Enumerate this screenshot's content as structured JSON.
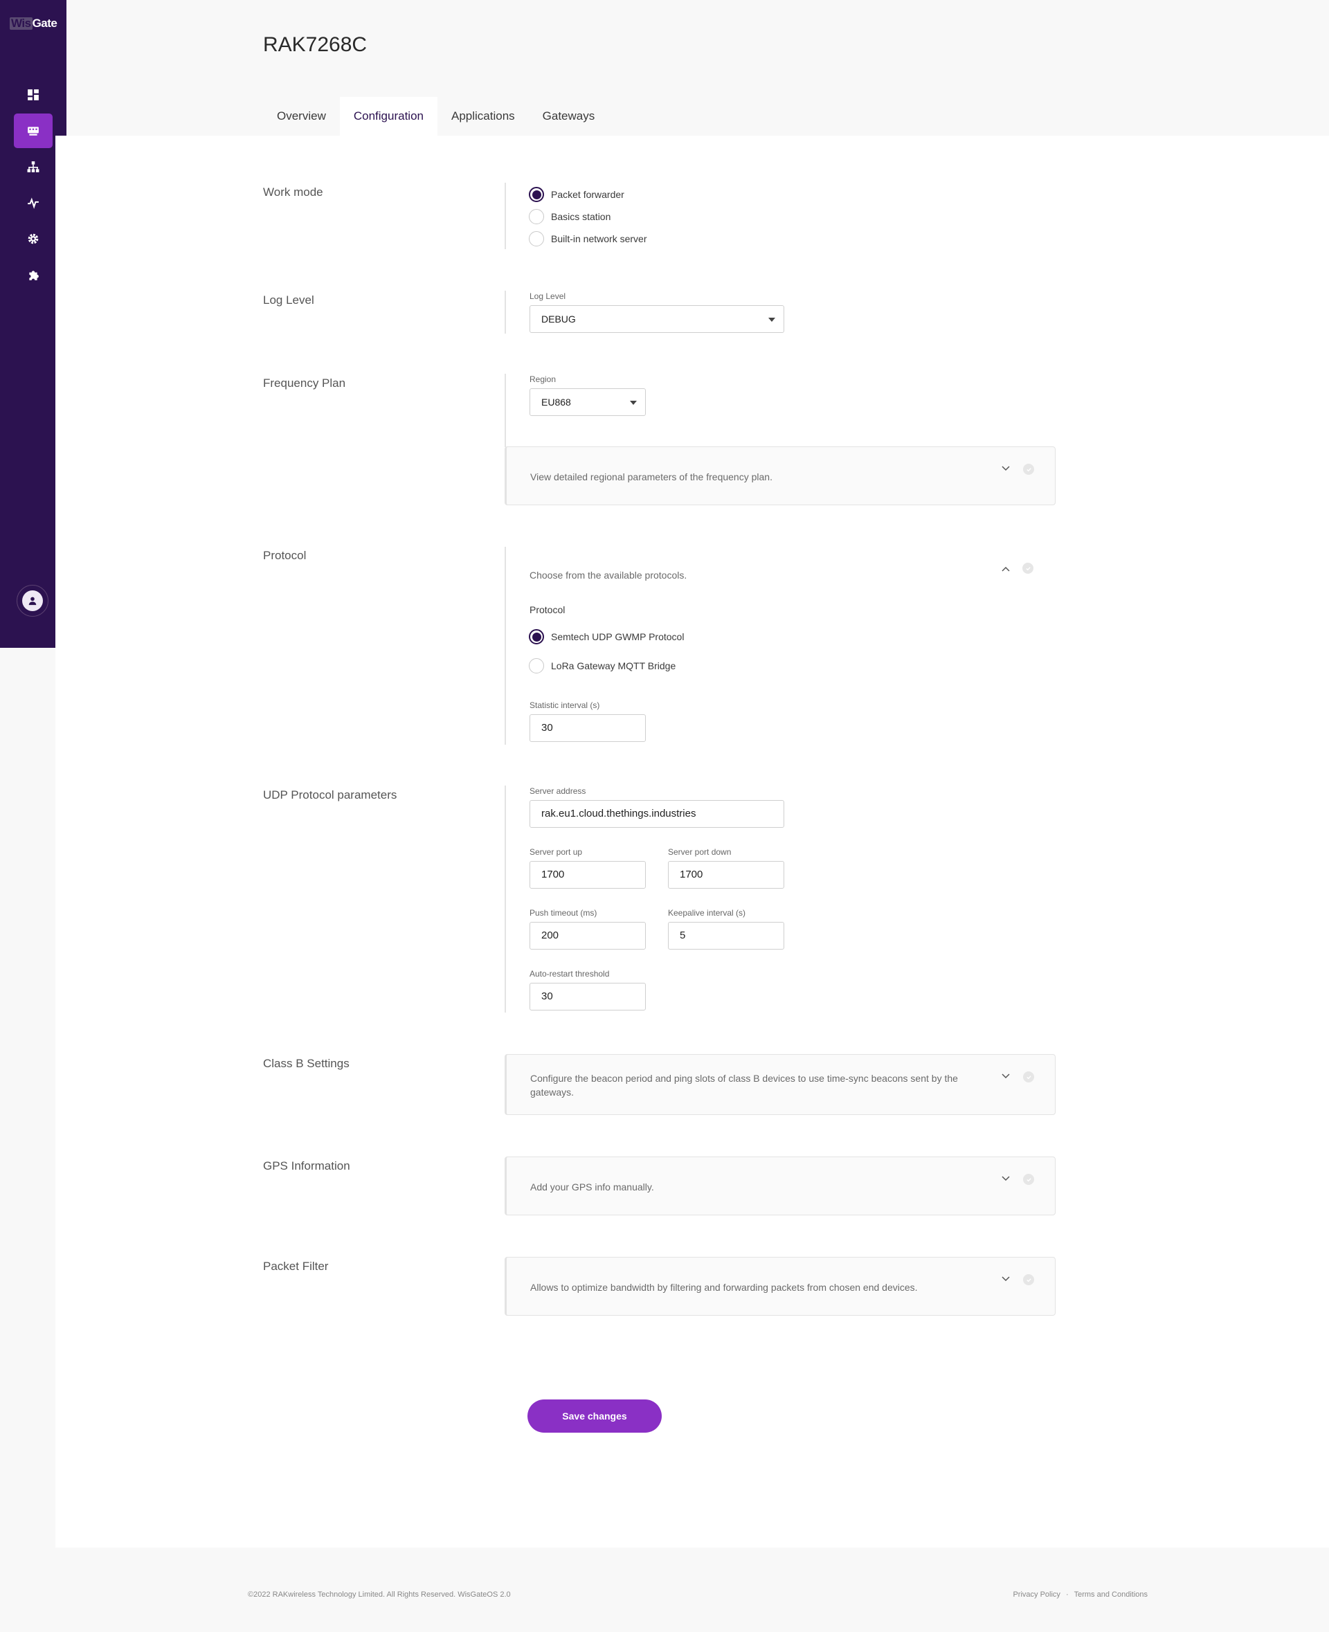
{
  "app": {
    "logo_part1": "Wis",
    "logo_part2": "Gate"
  },
  "sidebar": {
    "items": [
      {
        "icon": "dashboard-icon",
        "active": false
      },
      {
        "icon": "gateway-icon",
        "active": true
      },
      {
        "icon": "network-icon",
        "active": false
      },
      {
        "icon": "activity-icon",
        "active": false
      },
      {
        "icon": "gear-icon",
        "active": false
      },
      {
        "icon": "puzzle-icon",
        "active": false
      }
    ],
    "avatar_icon": "user-icon"
  },
  "page": {
    "title": "RAK7268C"
  },
  "tabs": [
    "Overview",
    "Configuration",
    "Applications",
    "Gateways"
  ],
  "active_tab": "Configuration",
  "work_mode": {
    "label": "Work mode",
    "options": [
      "Packet forwarder",
      "Basics station",
      "Built-in network server"
    ],
    "selected": "Packet forwarder"
  },
  "log_level": {
    "label": "Log Level",
    "field_label": "Log Level",
    "value": "DEBUG"
  },
  "frequency_plan": {
    "label": "Frequency Plan",
    "field_label": "Region",
    "value": "EU868",
    "info": "View detailed regional parameters of the frequency plan."
  },
  "protocol": {
    "label": "Protocol",
    "description": "Choose from the available protocols.",
    "group_label": "Protocol",
    "options": [
      "Semtech UDP GWMP Protocol",
      "LoRa Gateway MQTT Bridge"
    ],
    "selected": "Semtech UDP GWMP Protocol",
    "stat_label": "Statistic interval (s)",
    "stat_value": "30"
  },
  "udp": {
    "label": "UDP Protocol parameters",
    "server_address_label": "Server address",
    "server_address": "rak.eu1.cloud.thethings.industries",
    "port_up_label": "Server port up",
    "port_up": "1700",
    "port_down_label": "Server port down",
    "port_down": "1700",
    "push_timeout_label": "Push timeout (ms)",
    "push_timeout": "200",
    "keepalive_label": "Keepalive interval (s)",
    "keepalive": "5",
    "auto_restart_label": "Auto-restart threshold",
    "auto_restart": "30"
  },
  "class_b": {
    "label": "Class B Settings",
    "info": "Configure the beacon period and ping slots of class B devices to use time-sync beacons sent by the gateways."
  },
  "gps": {
    "label": "GPS Information",
    "info": "Add your GPS info manually."
  },
  "packet_filter": {
    "label": "Packet Filter",
    "info": "Allows to optimize bandwidth by filtering and forwarding packets from chosen end devices."
  },
  "actions": {
    "save": "Save changes"
  },
  "footer": {
    "copyright": "©2022 RAKwireless Technology Limited. All Rights Reserved. WisGateOS 2.0",
    "privacy": "Privacy Policy",
    "separator": "·",
    "terms": "Terms and Conditions"
  },
  "colors": {
    "sidebar": "#2c1250",
    "accent": "#8a30c5"
  }
}
